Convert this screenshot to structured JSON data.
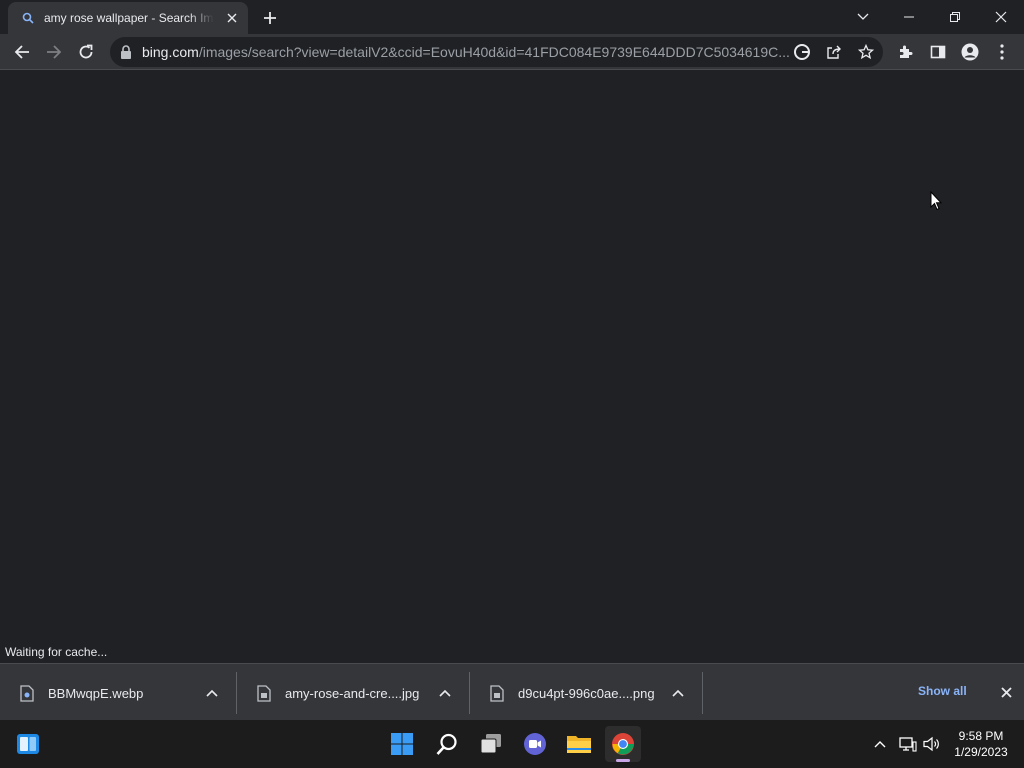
{
  "tab": {
    "title": "amy rose wallpaper - Search Images"
  },
  "address_bar": {
    "host": "bing.com",
    "path": "/images/search?view=detailV2&ccid=EovuH40d&id=41FDC084E9739E644DDD7C5034619C..."
  },
  "status": {
    "text": "Waiting for cache..."
  },
  "downloads": [
    {
      "name": "BBMwqpE.webp"
    },
    {
      "name": "amy-rose-and-cre....jpg"
    },
    {
      "name": "d9cu4pt-996c0ae....png"
    }
  ],
  "download_shelf": {
    "show_all_label": "Show all"
  },
  "clock": {
    "time": "9:58 PM",
    "date": "1/29/2023"
  },
  "colors": {
    "accent_link": "#8ab4f8",
    "chrome_bg": "#35363a",
    "page_bg": "#202124"
  }
}
